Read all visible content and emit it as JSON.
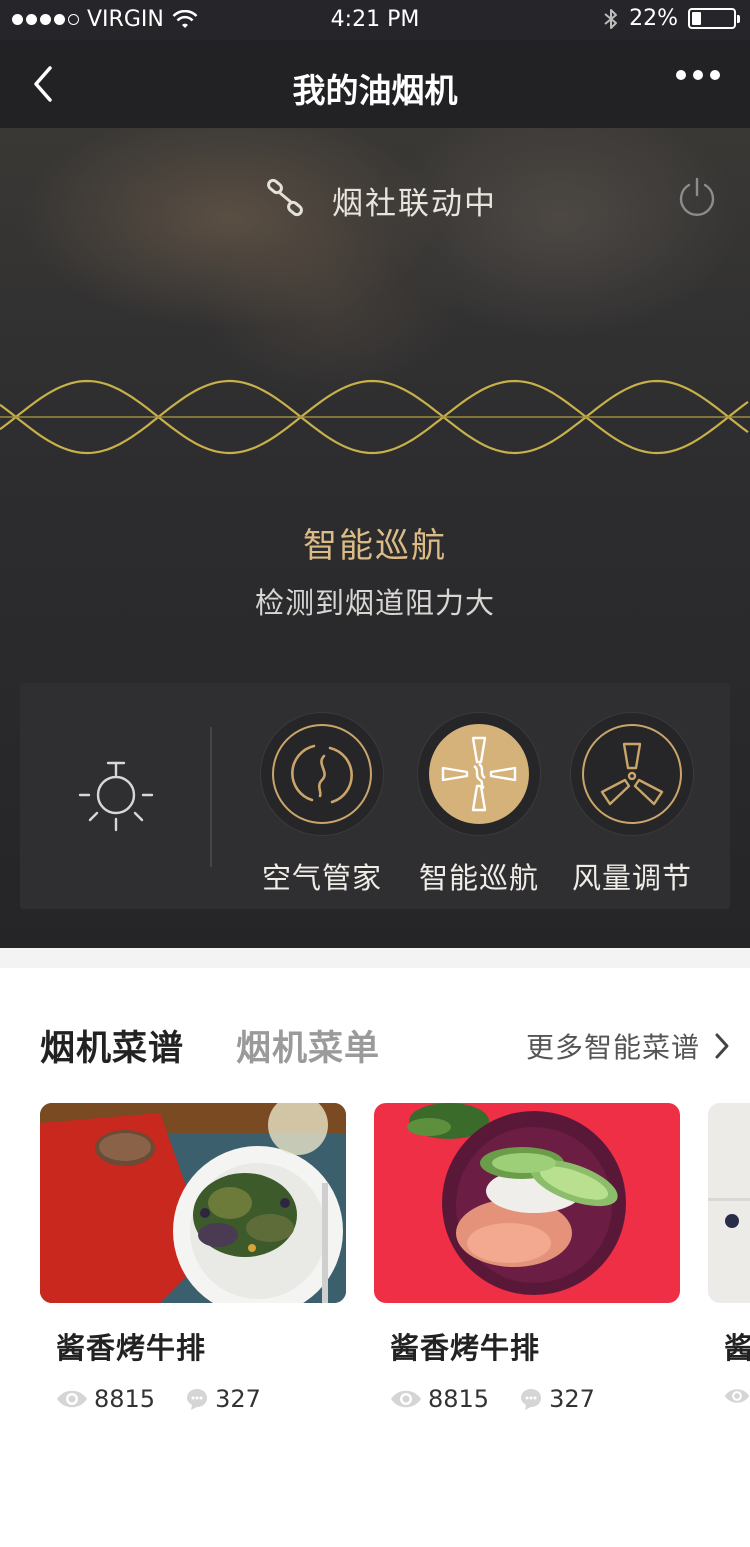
{
  "status_bar": {
    "carrier": "VIRGIN",
    "time": "4:21 PM",
    "battery": "22%",
    "battery_level": 0.22
  },
  "nav": {
    "title": "我的油烟机",
    "back_icon": "chevron-left-icon",
    "more_icon": "more-dots-icon"
  },
  "linkage": {
    "text": "烟社联动中",
    "icon": "link-icon",
    "power_icon": "power-icon"
  },
  "mode": {
    "title": "智能巡航",
    "description": "检测到烟道阻力大"
  },
  "controls": {
    "light_icon": "light-icon",
    "items": [
      {
        "label": "空气管家",
        "icon": "air-icon",
        "active": false
      },
      {
        "label": "智能巡航",
        "icon": "cruise-icon",
        "active": true
      },
      {
        "label": "风量调节",
        "icon": "fan-icon",
        "active": false
      }
    ]
  },
  "recipes": {
    "tabs": [
      {
        "label": "烟机菜谱",
        "active": true
      },
      {
        "label": "烟机菜单",
        "active": false
      }
    ],
    "more_label": "更多智能菜谱",
    "cards": [
      {
        "name": "酱香烤牛排",
        "views": "8815",
        "comments": "327"
      },
      {
        "name": "酱香烤牛排",
        "views": "8815",
        "comments": "327"
      },
      {
        "name": "酱",
        "views": "",
        "comments": ""
      }
    ]
  },
  "colors": {
    "accent_gold": "#d4b27a",
    "dark_bg": "#26262a",
    "wave_color": "#c8b04a"
  }
}
